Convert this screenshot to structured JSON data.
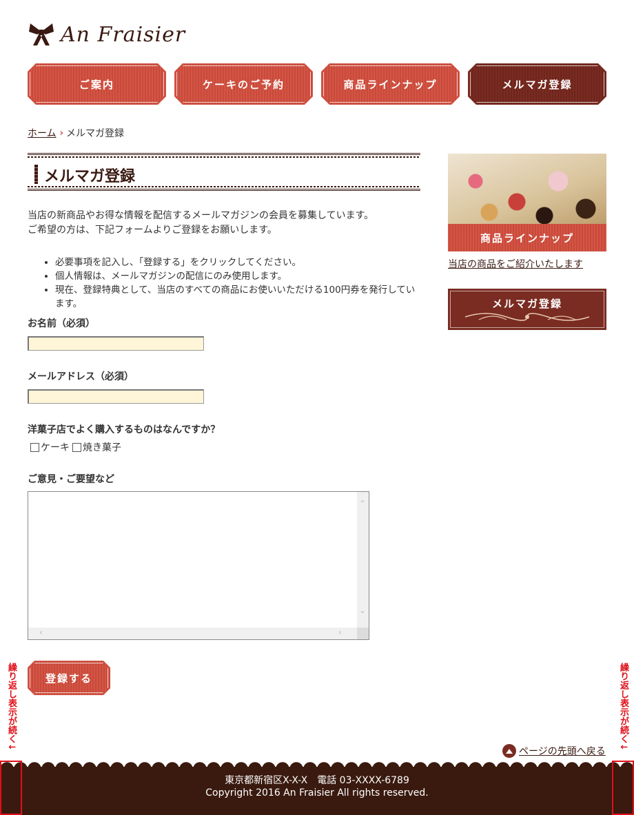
{
  "site": {
    "logo_text": "An Fraisier"
  },
  "nav": {
    "items": [
      {
        "label": "ご案内"
      },
      {
        "label": "ケーキのご予約"
      },
      {
        "label": "商品ラインナップ"
      },
      {
        "label": "メルマガ登録"
      }
    ],
    "active_index": 3
  },
  "breadcrumb": {
    "home": "ホーム",
    "separator": "›",
    "current": "メルマガ登録"
  },
  "main": {
    "title": "メルマガ登録",
    "intro_line1": "当店の新商品やお得な情報を配信するメールマガジンの会員を募集しています。",
    "intro_line2": "ご希望の方は、下記フォームよりご登録をお願いします。",
    "bullets": [
      "必要事項を記入し、「登録する」をクリックしてください。",
      "個人情報は、メールマガジンの配信にのみ使用します。",
      "現在、登録特典として、当店のすべての商品にお使いいただける100円券を発行しています。"
    ]
  },
  "form": {
    "name_label": "お名前（必須）",
    "name_value": "",
    "email_label": "メールアドレス（必須）",
    "email_value": "",
    "question_label": "洋菓子店でよく購入するものはなんですか？",
    "options": [
      {
        "label": "ケーキ",
        "checked": false
      },
      {
        "label": "焼き菓子",
        "checked": false
      }
    ],
    "comment_label": "ご意見・ご要望など",
    "comment_value": "",
    "submit_label": "登録する"
  },
  "sidebar": {
    "banner_label": "商品ラインナップ",
    "banner_link": "当店の商品をご紹介いたします",
    "mailmag_label": "メルマガ登録"
  },
  "back_to_top": "ページの先頭へ戻る",
  "footer": {
    "address": "東京都新宿区X-X-X　電話 03-XXXX-6789",
    "copyright": "Copyright 2016 An Fraisier All rights reserved."
  },
  "annotation": {
    "text": "繰り返し表示が続く↓"
  },
  "colors": {
    "accent_red": "#d35545",
    "dark_brown": "#3a1a0f",
    "maroon": "#7a2c22",
    "input_bg": "#fff6d9",
    "annotation_red": "#e0101a"
  }
}
